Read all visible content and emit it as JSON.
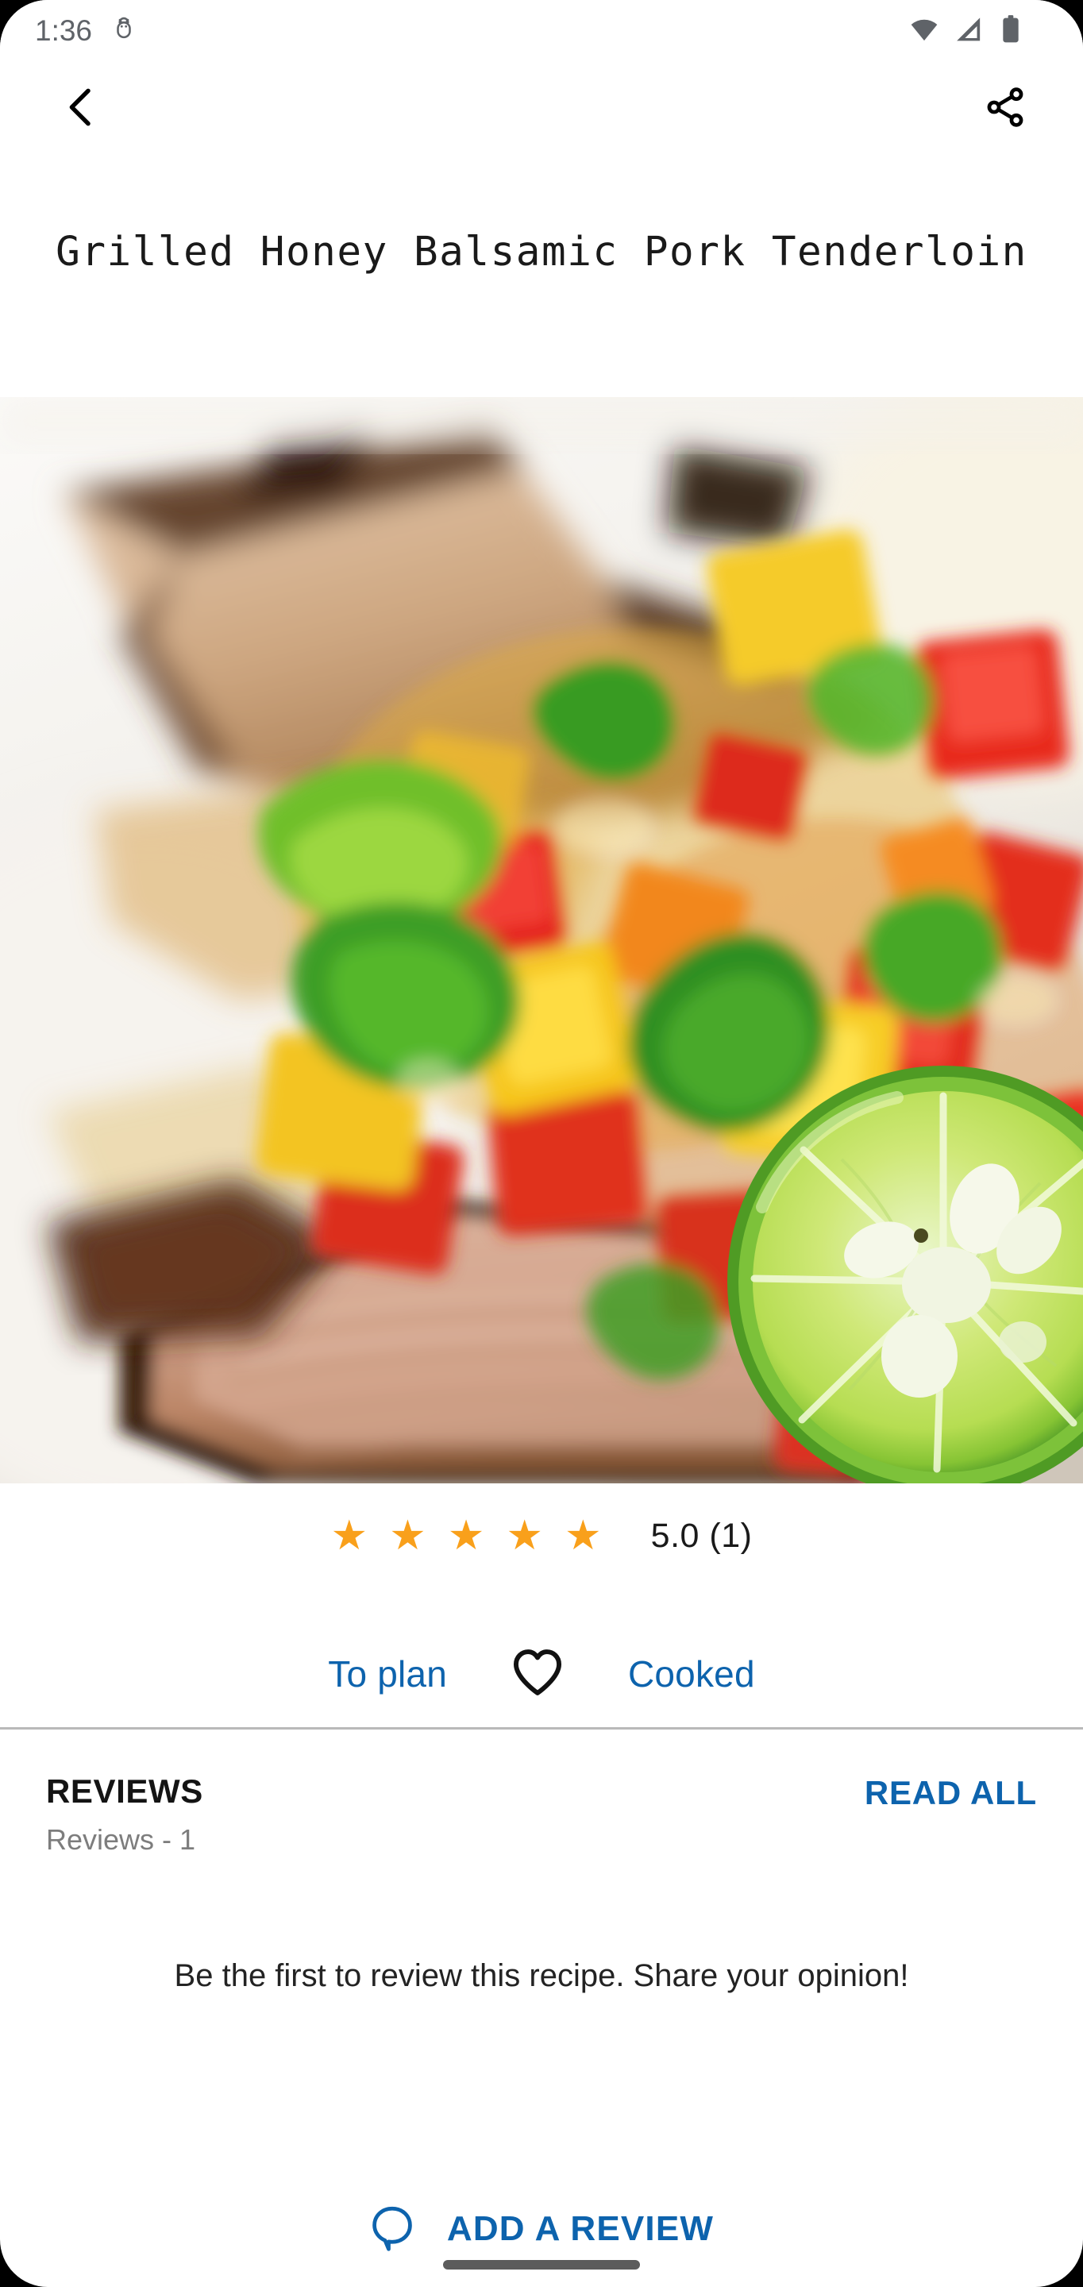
{
  "status_bar": {
    "time": "1:36",
    "icons": [
      "android-debug-icon",
      "wifi-icon",
      "cellular-signal-icon",
      "battery-icon"
    ]
  },
  "app_bar": {
    "back_icon": "back-chevron-icon",
    "share_icon": "share-icon"
  },
  "recipe": {
    "title": "Grilled Honey Balsamic Pork Tenderloin",
    "photo_alt": "Sliced grilled pork tenderloin with colorful mango pepper salsa and a lime half"
  },
  "rating": {
    "stars_filled": 5,
    "star_glyph": "★",
    "value_text": "5.0 (1)",
    "star_color": "#f9a01b"
  },
  "actions": {
    "to_plan_label": "To plan",
    "favorite_icon": "heart-outline-icon",
    "cooked_label": "Cooked",
    "accent_color": "#0d63ad"
  },
  "reviews": {
    "section_title": "REVIEWS",
    "count_label": "Reviews - 1",
    "read_all_label": "READ ALL",
    "empty_message": "Be the first to review this recipe. Share your opinion!"
  },
  "add_review": {
    "icon": "comment-bubble-icon",
    "label": "ADD A REVIEW"
  }
}
